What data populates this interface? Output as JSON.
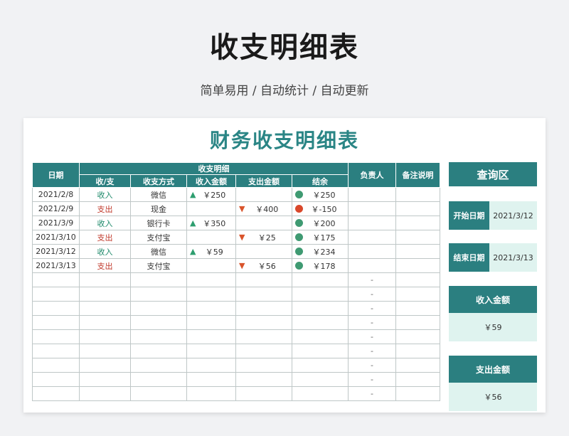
{
  "header": {
    "title": "收支明细表",
    "subtitle": "简单易用 / 自动统计 / 自动更新"
  },
  "sheet": {
    "title": "财务收支明细表",
    "columns": {
      "date": "日期",
      "group": "收支明细",
      "type": "收/支",
      "method": "收支方式",
      "income": "收入金额",
      "expense": "支出金额",
      "balance": "结余",
      "owner": "负责人",
      "note": "备注说明"
    },
    "rows": [
      {
        "date": "2021/2/8",
        "type": "收入",
        "method": "微信",
        "income": "￥250",
        "expense": "",
        "balance": "￥250",
        "status": "positive"
      },
      {
        "date": "2021/2/9",
        "type": "支出",
        "method": "现金",
        "income": "",
        "expense": "￥400",
        "balance": "￥-150",
        "status": "negative"
      },
      {
        "date": "2021/3/9",
        "type": "收入",
        "method": "银行卡",
        "income": "￥350",
        "expense": "",
        "balance": "￥200",
        "status": "positive"
      },
      {
        "date": "2021/3/10",
        "type": "支出",
        "method": "支付宝",
        "income": "",
        "expense": "￥25",
        "balance": "￥175",
        "status": "positive"
      },
      {
        "date": "2021/3/12",
        "type": "收入",
        "method": "微信",
        "income": "￥59",
        "expense": "",
        "balance": "￥234",
        "status": "positive"
      },
      {
        "date": "2021/3/13",
        "type": "支出",
        "method": "支付宝",
        "income": "",
        "expense": "￥56",
        "balance": "￥178",
        "status": "positive"
      }
    ],
    "empty_balance": "-",
    "empty_row_count": 9
  },
  "query": {
    "title": "查询区",
    "start_label": "开始日期",
    "start_value": "2021/3/12",
    "end_label": "结束日期",
    "end_value": "2021/3/13",
    "income_label": "收入金额",
    "income_value": "￥59",
    "expense_label": "支出金额",
    "expense_value": "￥56"
  },
  "colors": {
    "teal": "#2b7f80",
    "title_teal": "#2a8585",
    "light_teal": "#dff3ef",
    "income_green": "#1e8a6b",
    "expense_red": "#c0392b"
  },
  "icons": {
    "income_arrow": "arrow-up-icon",
    "expense_arrow": "arrow-down-icon",
    "balance_status": "status-dot-icon"
  }
}
